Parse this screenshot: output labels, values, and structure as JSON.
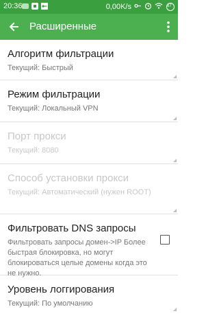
{
  "status": {
    "time": "20:36",
    "network_speed": "0,00K/s",
    "battery_badge": "87",
    "icons": [
      "green-app-icon",
      "notification-icon",
      "vpn-key-icon",
      "alarm-icon",
      "wifi-icon",
      "battery-icon"
    ]
  },
  "appbar": {
    "title": "Расширенные",
    "back_icon": "arrow-left-icon",
    "menu_icon": "more-vert-icon"
  },
  "settings": [
    {
      "title": "Алгоритм фильтрации",
      "summary": "Текущий: Быстрый",
      "enabled": true
    },
    {
      "title": "Режим фильтрации",
      "summary": "Текущий: Локальный VPN",
      "enabled": true
    },
    {
      "title": "Порт прокси",
      "summary": "Текущий: 8080",
      "enabled": false
    },
    {
      "title": "Способ установки прокси",
      "summary": "Текущий: Автоматический (нужен ROOT)",
      "enabled": false
    },
    {
      "title": "Фильтровать DNS запросы",
      "summary": "Фильтровать запросы домен->IP Более быстрая блокировка, но могут блокироваться целые домены когда это не нужно.",
      "enabled": true,
      "checked": false
    },
    {
      "title": "Уровень логгирования",
      "summary": "Текущий: По умолчанию",
      "enabled": true
    }
  ],
  "colors": {
    "statusbar": "#3a9f3e",
    "appbar": "#4caf50",
    "disabled_text": "#c8c8c8"
  }
}
